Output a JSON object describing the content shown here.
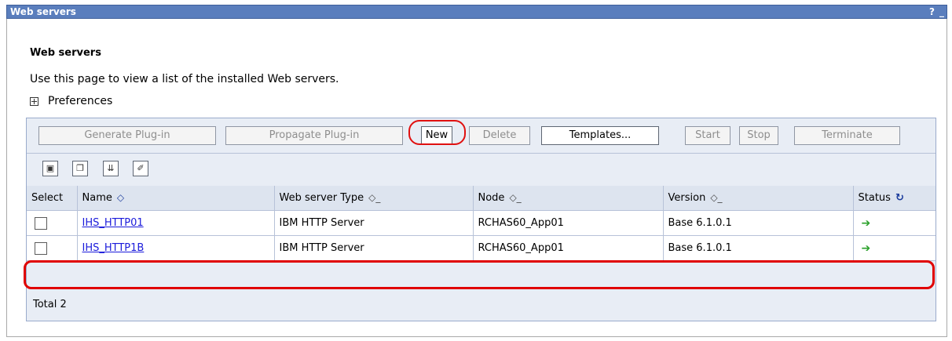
{
  "window": {
    "title": "Web servers",
    "help": "?",
    "minimize": "_"
  },
  "page": {
    "heading": "Web servers",
    "description": "Use this page to view a list of the installed Web servers.",
    "preferences": "Preferences"
  },
  "toolbar": {
    "generate_plugin": "Generate Plug-in",
    "propagate_plugin": "Propagate Plug-in",
    "new": "New",
    "delete": "Delete",
    "templates": "Templates...",
    "start": "Start",
    "stop": "Stop",
    "terminate": "Terminate"
  },
  "table": {
    "headers": {
      "select": "Select",
      "name": "Name",
      "type": "Web server Type",
      "node": "Node",
      "version": "Version",
      "status": "Status"
    },
    "rows": [
      {
        "name": "IHS_HTTP01",
        "type": "IBM HTTP Server",
        "node": "RCHAS60_App01",
        "version": "Base 6.1.0.1",
        "status_icon": "started-arrow-icon"
      },
      {
        "name": "IHS_HTTP1B",
        "type": "IBM HTTP Server",
        "node": "RCHAS60_App01",
        "version": "Base 6.1.0.1",
        "status_icon": "started-arrow-icon"
      }
    ],
    "total": "Total 2"
  },
  "colors": {
    "titlebar": "#5a7ebd",
    "highlight": "#e00000",
    "link": "#1a1adb",
    "status_running": "#2aa02a"
  }
}
